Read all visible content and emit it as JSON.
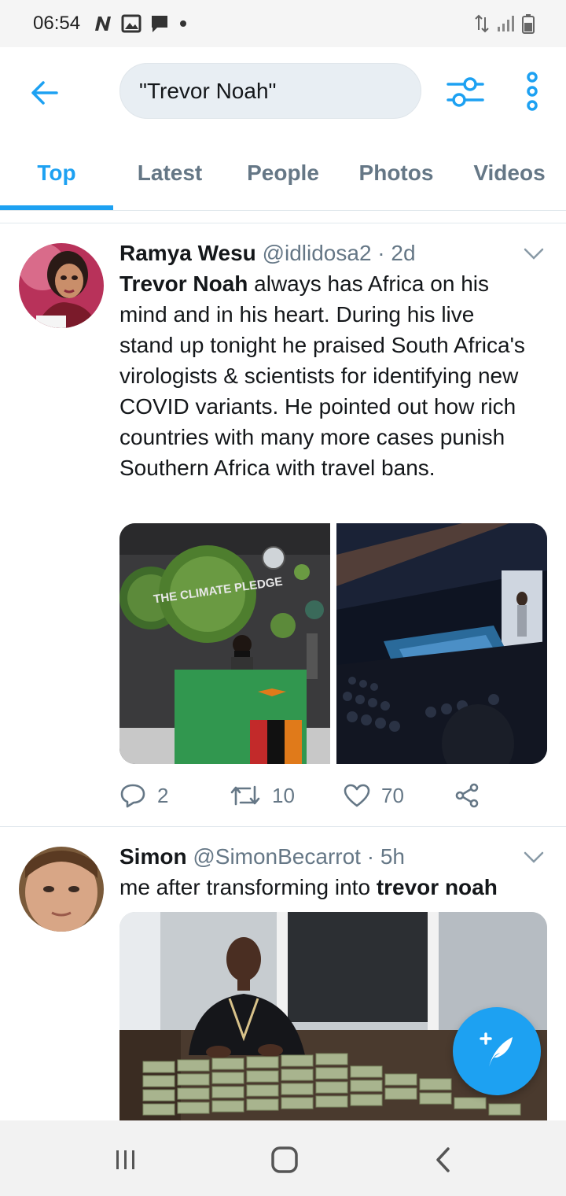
{
  "status_bar": {
    "time": "06:54",
    "left_icons": [
      "n-icon",
      "image-icon",
      "message-icon",
      "dot-icon"
    ],
    "right_icons": [
      "data-arrows-icon",
      "signal-icon",
      "battery-icon"
    ]
  },
  "header": {
    "search_value": "\"Trevor Noah\"",
    "back_icon": "arrow-left-icon",
    "filter_icon": "sliders-icon",
    "more_icon": "more-vertical-icon"
  },
  "tabs": [
    {
      "label": "Top",
      "active": true
    },
    {
      "label": "Latest",
      "active": false
    },
    {
      "label": "People",
      "active": false
    },
    {
      "label": "Photos",
      "active": false
    },
    {
      "label": "Videos",
      "active": false
    }
  ],
  "tweets": [
    {
      "name": "Ramya Wesu",
      "meta": "@idlidosa2 · 2d",
      "text_bold": "Trevor Noah",
      "text_rest": " always has Africa on his mind and in his heart. During his live stand up tonight he praised South Africa's virologists & scientists for identifying new COVID variants. He pointed out how rich countries with many more cases punish Southern Africa with travel bans.",
      "media_image_text": "THE CLIMATE PLEDGE",
      "actions": {
        "replies": "2",
        "retweets": "10",
        "likes": "70"
      }
    },
    {
      "name": "Simon",
      "meta": "@SimonBecarrot · 5h",
      "text_plain": "me after transforming into ",
      "text_bold": "trevor noah"
    }
  ],
  "colors": {
    "accent": "#1da1f2",
    "text_primary": "#14171a",
    "text_secondary": "#657786",
    "divider": "#e1e8ed"
  },
  "fab": {
    "icon": "compose-icon"
  },
  "nav_bar": {
    "icons": [
      "recent-apps-icon",
      "home-icon",
      "back-icon"
    ]
  }
}
